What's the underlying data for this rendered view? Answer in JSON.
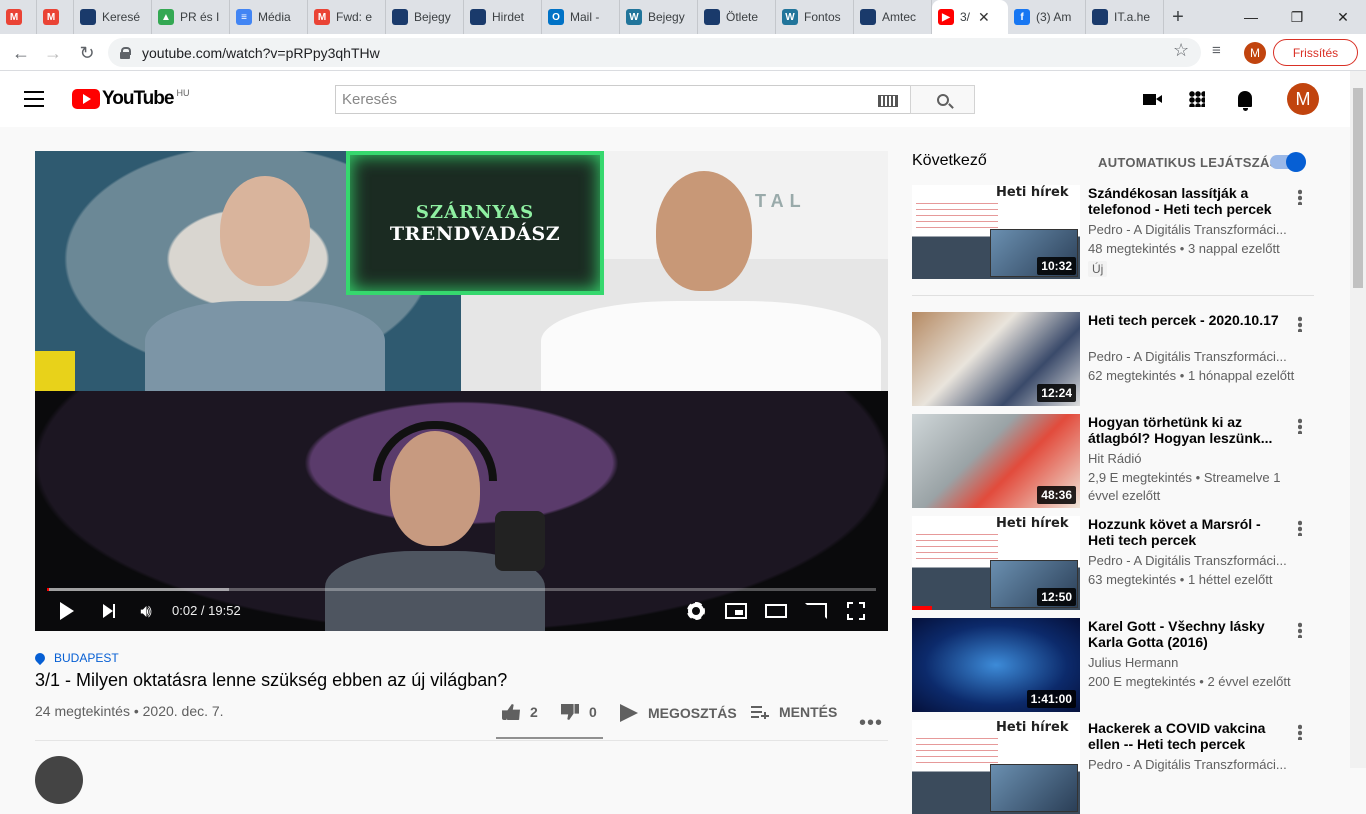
{
  "browser": {
    "tabs": [
      {
        "label": "",
        "icon": "gmail-icon"
      },
      {
        "label": "",
        "icon": "gmail-icon"
      },
      {
        "label": "Keresé",
        "icon": "page-icon"
      },
      {
        "label": "PR és I",
        "icon": "drive-icon"
      },
      {
        "label": "Média",
        "icon": "docs-icon"
      },
      {
        "label": "Fwd: e",
        "icon": "gmail-icon"
      },
      {
        "label": "Bejegy",
        "icon": "page-icon"
      },
      {
        "label": "Hirdet",
        "icon": "page-icon"
      },
      {
        "label": "Mail -",
        "icon": "outlook-icon"
      },
      {
        "label": "Bejegy",
        "icon": "wordpress-icon"
      },
      {
        "label": "Ötlete",
        "icon": "page-icon"
      },
      {
        "label": "Fontos",
        "icon": "wordpress-icon"
      },
      {
        "label": "Amtec",
        "icon": "page-icon"
      },
      {
        "label": "3/",
        "icon": "youtube-icon",
        "active": true
      },
      {
        "label": "(3) Am",
        "icon": "facebook-icon"
      },
      {
        "label": "IT.a.he",
        "icon": "page-icon"
      }
    ],
    "url": "youtube.com/watch?v=pRPpy3qhTHw",
    "profile_initial": "M",
    "update_label": "Frissítés"
  },
  "youtube": {
    "logo_text": "YouTube",
    "country_code": "HU",
    "search_placeholder": "Keresés",
    "avatar_initial": "M"
  },
  "player": {
    "time_current": "0:02",
    "time_total": "19:52",
    "time_display": "0:02 / 19:52",
    "progress_played_fraction": 0.002,
    "progress_buffered_fraction": 0.22,
    "show_logo_line1": "SZÁRNYAS",
    "show_logo_line2": "TRENDVADÁSZ",
    "background_sign": "TAL"
  },
  "video": {
    "location": "BUDAPEST",
    "title": "3/1 - Milyen oktatásra lenne szükség ebben az új világban?",
    "meta": "24 megtekintés • 2020. dec. 7.",
    "likes": "2",
    "dislikes": "0",
    "share_label": "MEGOSZTÁS",
    "save_label": "MENTÉS",
    "more_label": "•••"
  },
  "sidebar": {
    "up_next_label": "Következő",
    "autoplay_label": "AUTOMATIKUS LEJÁTSZÁS",
    "autoplay_on": true,
    "items": [
      {
        "title": "Szándékosan lassítják a telefonod - Heti tech percek",
        "channel": "Pedro - A Digitális Transzformáci...",
        "stats": "48 megtekintés • 3 nappal ezelőtt",
        "badge": "Új",
        "duration": "10:32",
        "thumb_heading": "Heti hírek"
      },
      {
        "title": "Heti tech percek - 2020.10.17",
        "channel": "Pedro - A Digitális Transzformáci...",
        "stats": "62 megtekintés • 1 hónappal ezelőtt",
        "duration": "12:24"
      },
      {
        "title": "Hogyan törhetünk ki az átlagból? Hogyan leszünk...",
        "channel": "Hit Rádió",
        "stats": "2,9 E megtekintés • Streamelve 1 évvel ezelőtt",
        "duration": "48:36"
      },
      {
        "title": "Hozzunk követ a Marsról - Heti tech percek",
        "channel": "Pedro - A Digitális Transzformáci...",
        "stats": "63 megtekintés • 1 héttel ezelőtt",
        "duration": "12:50",
        "thumb_heading": "Heti hírek"
      },
      {
        "title": "Karel Gott - Všechny lásky Karla Gotta (2016)",
        "channel": "Julius Hermann",
        "stats": "200 E megtekintés • 2 évvel ezelőtt",
        "duration": "1:41:00"
      },
      {
        "title": "Hackerek a COVID vakcina ellen -- Heti tech percek",
        "channel": "Pedro - A Digitális Transzformáci...",
        "stats": "",
        "duration": "",
        "thumb_heading": "Heti hírek"
      }
    ]
  },
  "colors": {
    "accent_red": "#ff0000",
    "link_blue": "#065fd4",
    "text_secondary": "#606060",
    "update_red": "#d93025",
    "avatar": "#c1440e"
  }
}
